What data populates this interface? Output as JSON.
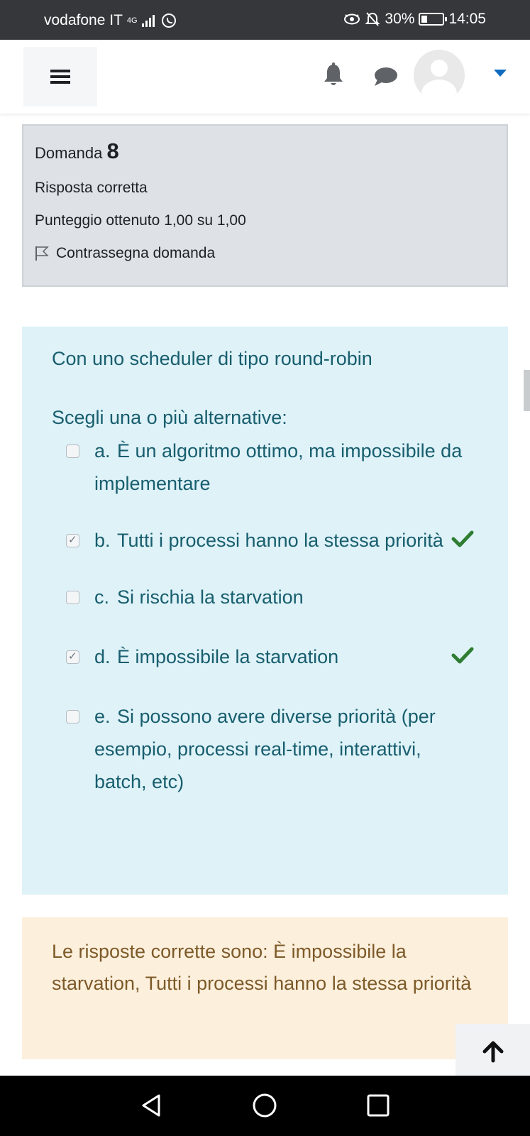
{
  "status_bar": {
    "carrier": "vodafone IT",
    "network": "4G",
    "battery": "30%",
    "battery_level": 0.3,
    "time": "14:05"
  },
  "navbar": {
    "menu_icon": "hamburger-icon",
    "notifications_icon": "bell-icon",
    "messages_icon": "chat-icon",
    "user_menu_icon": "caret-down-icon",
    "accent_color": "#0f6cbf"
  },
  "question_info": {
    "label": "Domanda",
    "number": "8",
    "state": "Risposta corretta",
    "grade": "Punteggio ottenuto 1,00 su 1,00",
    "flag_label": "Contrassegna domanda"
  },
  "question": {
    "text": "Con uno scheduler di tipo round-robin",
    "prompt": "Scegli una o più alternative:",
    "answers": [
      {
        "letter": "a.",
        "text": "È un algoritmo ottimo, ma impossibile da implementare",
        "checked": false,
        "correct": false
      },
      {
        "letter": "b.",
        "text": "Tutti i processi hanno la stessa priorità",
        "checked": true,
        "correct": true
      },
      {
        "letter": "c.",
        "text": "Si rischia la starvation",
        "checked": false,
        "correct": false
      },
      {
        "letter": "d.",
        "text": "È impossibile la starvation",
        "checked": true,
        "correct": true
      },
      {
        "letter": "e.",
        "text": "Si possono avere diverse priorità (per esempio, processi real-time, interattivi, batch, etc)",
        "checked": false,
        "correct": false
      }
    ]
  },
  "feedback": {
    "text": "Le risposte corrette sono: È impossibile la starvation, Tutti i processi hanno la stessa priorità"
  },
  "colors": {
    "info_bg": "#dee2e6",
    "question_bg": "#def2f8",
    "question_text": "#185e6e",
    "feedback_bg": "#fcefdc",
    "feedback_text": "#7d5a29",
    "correct_green": "#2e7d32"
  }
}
